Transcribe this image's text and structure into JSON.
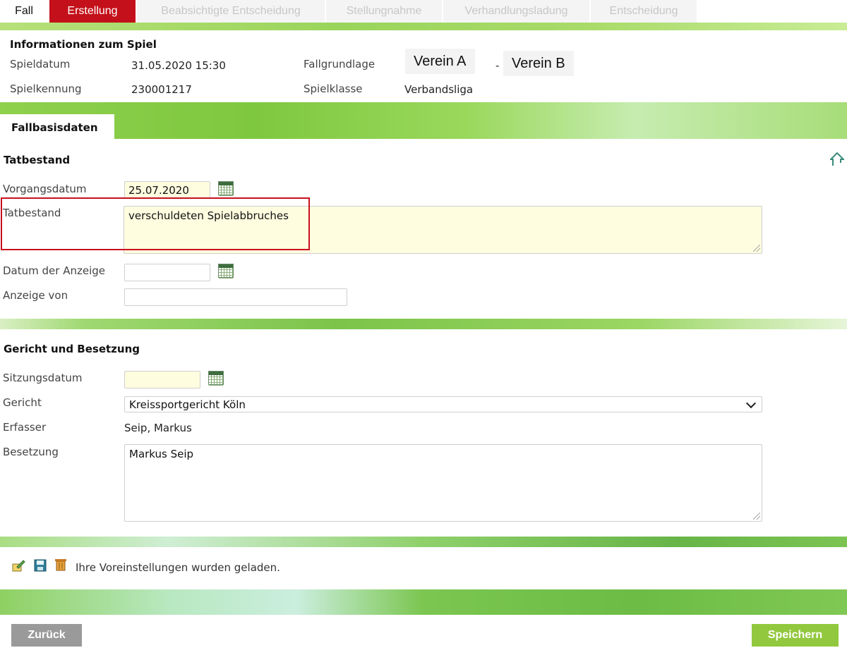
{
  "tabs": [
    {
      "label": "Fall"
    },
    {
      "label": "Erstellung"
    },
    {
      "label": "Beabsichtigte Entscheidung"
    },
    {
      "label": "Stellungnahme"
    },
    {
      "label": "Verhandlungsladung"
    },
    {
      "label": "Entscheidung"
    }
  ],
  "info": {
    "title": "Informationen zum Spiel",
    "spieldatum_label": "Spieldatum",
    "spieldatum_value": "31.05.2020 15:30",
    "spielkennung_label": "Spielkennung",
    "spielkennung_value": "230001217",
    "fallgrundlage_label": "Fallgrundlage",
    "verein_a": "Verein A",
    "separator": "-",
    "verein_b": "Verein B",
    "spielklasse_label": "Spielklasse",
    "spielklasse_value": "Verbandsliga"
  },
  "subtab": {
    "label": "Fallbasisdaten"
  },
  "tatbestand_section": {
    "title": "Tatbestand",
    "vorgangsdatum_label": "Vorgangsdatum",
    "vorgangsdatum_value": "25.07.2020",
    "tatbestand_label": "Tatbestand",
    "tatbestand_value": "verschuldeten Spielabbruches",
    "datum_anzeige_label": "Datum der Anzeige",
    "datum_anzeige_value": "",
    "anzeige_von_label": "Anzeige von",
    "anzeige_von_value": ""
  },
  "gericht_section": {
    "title": "Gericht und Besetzung",
    "sitzungsdatum_label": "Sitzungsdatum",
    "sitzungsdatum_value": "",
    "gericht_label": "Gericht",
    "gericht_value": "Kreissportgericht Köln",
    "erfasser_label": "Erfasser",
    "erfasser_value": "Seip, Markus",
    "besetzung_label": "Besetzung",
    "besetzung_value": "Markus Seip"
  },
  "status": {
    "message": "Ihre Voreinstellungen wurden geladen."
  },
  "buttons": {
    "back": "Zurück",
    "save": "Speichern"
  },
  "colors": {
    "active_tab": "#c4101a",
    "save_button": "#92c83e",
    "back_button": "#9a9a9a",
    "highlight_border": "#c8101d",
    "input_yellow": "#fffde0"
  },
  "icons": [
    "calendar-icon",
    "scroll-up-icon",
    "edit-settings-icon",
    "save-settings-icon",
    "delete-settings-icon",
    "chevron-down-icon"
  ]
}
